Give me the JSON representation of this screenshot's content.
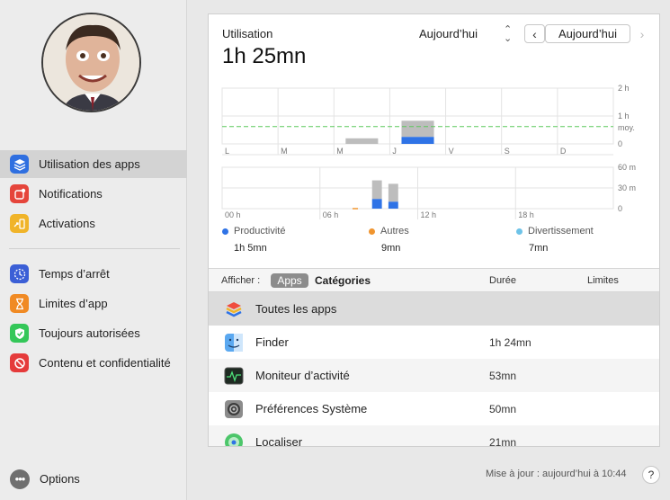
{
  "sidebar": {
    "items": [
      {
        "label": "Utilisation des apps",
        "icon": "layers-icon",
        "color": "#2f6fe0"
      },
      {
        "label": "Notifications",
        "icon": "notification-icon",
        "color": "#e5453b"
      },
      {
        "label": "Activations",
        "icon": "pickup-icon",
        "color": "#f0b429"
      },
      {
        "label": "Temps d’arrêt",
        "icon": "downtime-icon",
        "color": "#3b5fd6"
      },
      {
        "label": "Limites d’app",
        "icon": "hourglass-icon",
        "color": "#f08a24"
      },
      {
        "label": "Toujours autorisées",
        "icon": "checkmark-icon",
        "color": "#34c759"
      },
      {
        "label": "Contenu et confidentialité",
        "icon": "restricted-icon",
        "color": "#e53b3b"
      }
    ],
    "options_label": "Options"
  },
  "header": {
    "usage_label": "Utilisation",
    "usage_total": "1h 25mn",
    "period": "Aujourd’hui",
    "date_button": "Aujourd’hui"
  },
  "chart_data": [
    {
      "type": "bar",
      "categories": [
        "L",
        "M",
        "M",
        "J",
        "V",
        "S",
        "D"
      ],
      "y_tick_labels": [
        "2 h",
        "1 h",
        "0"
      ],
      "avg_label": "moy.",
      "avg_value_h": 0.62,
      "ylim": [
        0,
        2
      ],
      "series": [
        {
          "name": "Productivité",
          "values": [
            0,
            0,
            0,
            0.25,
            0,
            0,
            0
          ]
        },
        {
          "name": "Autres",
          "values": [
            0,
            0,
            0,
            0,
            0,
            0,
            0
          ]
        },
        {
          "name": "Divertissement",
          "values": [
            0,
            0,
            0,
            0,
            0,
            0,
            0
          ]
        }
      ],
      "other_values": [
        0,
        0,
        0.2,
        0.58,
        0,
        0,
        0
      ]
    },
    {
      "type": "bar",
      "x_tick_labels": [
        "00 h",
        "06 h",
        "12 h",
        "18 h"
      ],
      "y_tick_labels": [
        "60 m",
        "30 m",
        "0"
      ],
      "ylim": [
        0,
        60
      ],
      "hours": [
        9,
        10
      ],
      "productivity": [
        14,
        10
      ],
      "other": [
        27,
        26
      ]
    }
  ],
  "legend": [
    {
      "label": "Productivité",
      "value": "1h 5mn",
      "color": "#2f73e6"
    },
    {
      "label": "Autres",
      "value": "9mn",
      "color": "#f0952f"
    },
    {
      "label": "Divertissement",
      "value": "7mn",
      "color": "#6ec3e8"
    }
  ],
  "table": {
    "show_label": "Afficher :",
    "seg_apps": "Apps",
    "seg_categories": "Catégories",
    "col_duration": "Durée",
    "col_limits": "Limites",
    "rows": [
      {
        "name": "Toutes les apps",
        "duration": "",
        "icon": "all-apps-icon"
      },
      {
        "name": "Finder",
        "duration": "1h 24mn",
        "icon": "finder-icon"
      },
      {
        "name": "Moniteur d’activité",
        "duration": "53mn",
        "icon": "activity-monitor-icon"
      },
      {
        "name": "Préférences Système",
        "duration": "50mn",
        "icon": "system-preferences-icon"
      },
      {
        "name": "Localiser",
        "duration": "21mn",
        "icon": "find-my-icon"
      }
    ]
  },
  "footer": {
    "update_text": "Mise à jour : aujourd’hui à 10:44",
    "help_label": "?"
  }
}
